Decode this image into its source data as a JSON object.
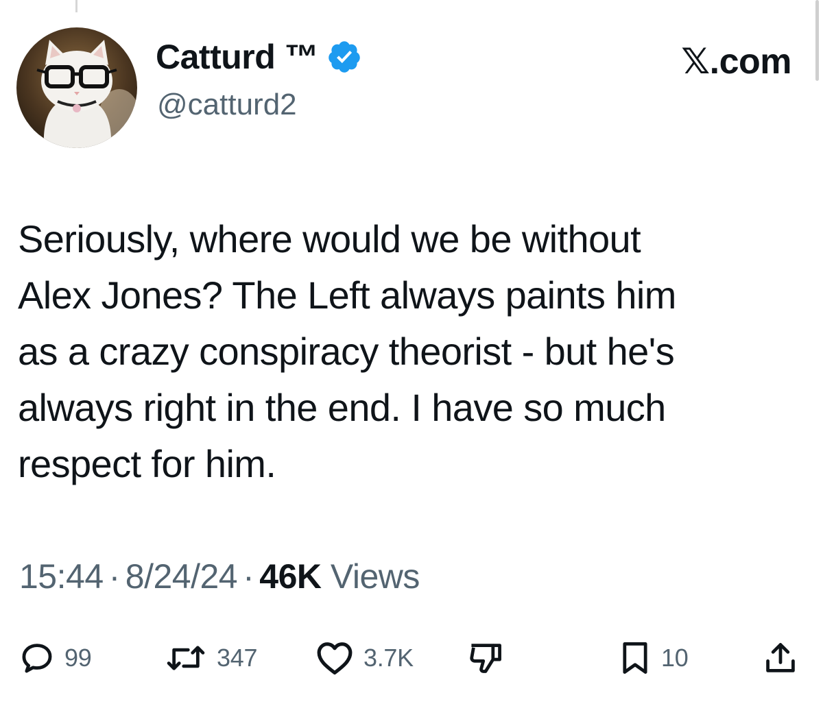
{
  "user": {
    "display_name": "Catturd ™",
    "handle": "@catturd2",
    "avatar": "cat-with-glasses-avatar",
    "verified_icon": "verified-badge-icon",
    "verified_color": "#1d9bf0"
  },
  "brand": "𝕏.com",
  "tweet": {
    "lines": [
      "Seriously, where would we be without",
      "Alex Jones?  The Left always paints him",
      "as a crazy conspiracy theorist - but he's",
      "always right in the end. I have so much",
      "respect for him."
    ]
  },
  "meta": {
    "time": "15:44",
    "separator": "·",
    "date": "8/24/24",
    "views_count": "46K",
    "views_label": "Views"
  },
  "actions": {
    "reply": {
      "icon": "reply-icon",
      "count": "99"
    },
    "retweet": {
      "icon": "retweet-icon",
      "count": "347"
    },
    "like": {
      "icon": "heart-icon",
      "count": "3.7K"
    },
    "dislike": {
      "icon": "thumbs-down-icon"
    },
    "bookmark": {
      "icon": "bookmark-icon",
      "count": "10"
    },
    "share": {
      "icon": "share-icon"
    }
  },
  "colors": {
    "text_primary": "#0f1419",
    "text_secondary": "#536471",
    "accent": "#1d9bf0"
  }
}
